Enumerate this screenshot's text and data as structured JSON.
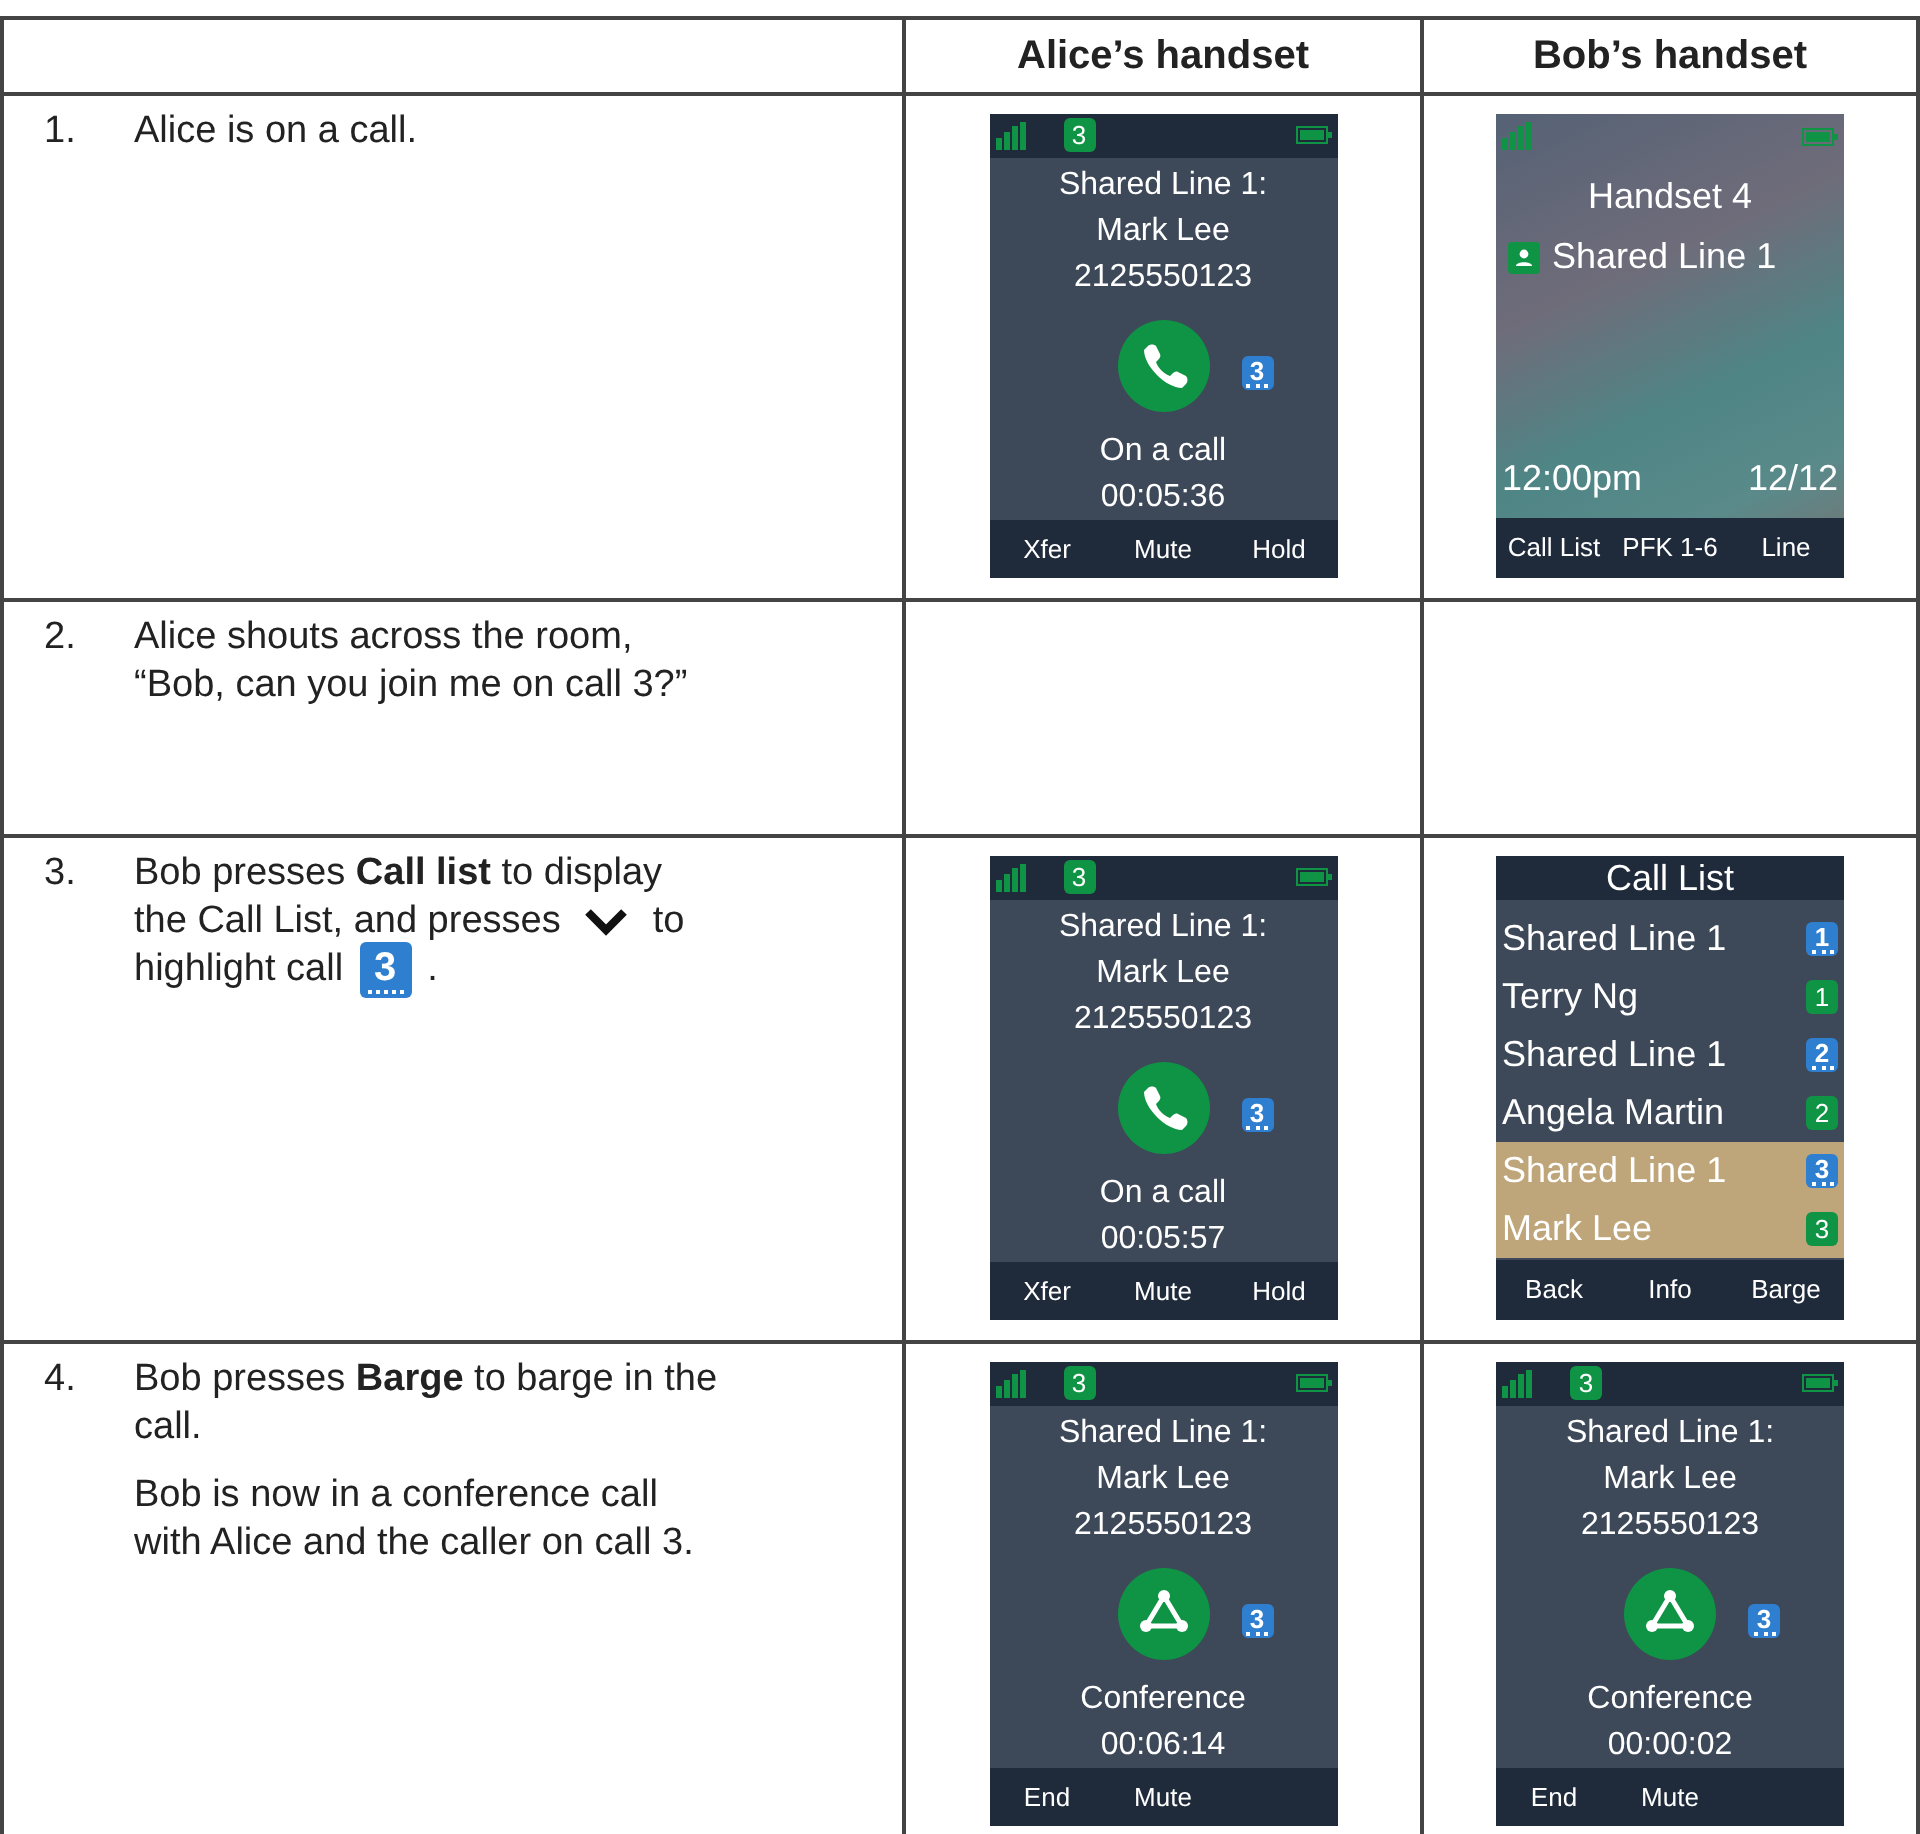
{
  "columns": [
    {
      "label": "Alice’s handset"
    },
    {
      "label": "Bob’s handset"
    }
  ],
  "steps": [
    {
      "number": "1.",
      "paragraphs": [
        [
          [
            {
              "kind": "text",
              "text": "Alice is on a call."
            }
          ]
        ]
      ],
      "alice": {
        "kind": "call",
        "line_badge": "3",
        "lines": [
          "Shared Line 1:",
          "Mark Lee",
          "2125550123"
        ],
        "call_icon": {
          "kind": "phone"
        },
        "call_number": "3",
        "status": "On a call",
        "timer": "00:05:36",
        "softkeys": [
          "Xfer",
          "Mute",
          "Hold"
        ]
      },
      "bob": {
        "kind": "idle",
        "title": "Handset 4",
        "line": "Shared Line 1",
        "time": "12:00pm",
        "date": "12/12",
        "softkeys": [
          "Call List",
          "PFK 1-6",
          "Line"
        ]
      }
    },
    {
      "number": "2.",
      "paragraphs": [
        [
          [
            {
              "kind": "text",
              "text": "Alice shouts across the room,"
            }
          ],
          [
            {
              "kind": "text",
              "text": "“Bob, can you join me on call 3?”"
            }
          ]
        ]
      ]
    },
    {
      "number": "3.",
      "paragraphs": [
        [
          [
            {
              "kind": "text",
              "text": "Bob presses **Call list** to display"
            }
          ],
          [
            {
              "kind": "text",
              "text": "the Call List, and presses"
            },
            {
              "kind": "down_key"
            },
            {
              "kind": "text",
              "text": "to"
            }
          ],
          [
            {
              "kind": "text",
              "text": "highlight call"
            },
            {
              "kind": "call_badge",
              "text": "3"
            },
            {
              "kind": "text",
              "text": "."
            }
          ]
        ]
      ],
      "alice": {
        "kind": "call",
        "line_badge": "3",
        "lines": [
          "Shared Line 1:",
          "Mark Lee",
          "2125550123"
        ],
        "call_icon": {
          "kind": "phone"
        },
        "call_number": "3",
        "status": "On a call",
        "timer": "00:05:57",
        "softkeys": [
          "Xfer",
          "Mute",
          "Hold"
        ]
      },
      "bob": {
        "kind": "call_list",
        "title": "Call List",
        "items": [
          {
            "label": "Shared Line 1",
            "badge": {
              "kind": "shared",
              "text": "1"
            },
            "selected": false
          },
          {
            "label": "Terry Ng",
            "badge": {
              "kind": "call",
              "text": "1"
            },
            "selected": false
          },
          {
            "label": "Shared Line 1",
            "badge": {
              "kind": "shared",
              "text": "2"
            },
            "selected": false
          },
          {
            "label": "Angela Martin",
            "badge": {
              "kind": "call",
              "text": "2"
            },
            "selected": false
          },
          {
            "label": "Shared Line 1",
            "badge": {
              "kind": "shared",
              "text": "3"
            },
            "selected": true
          },
          {
            "label": "Mark Lee",
            "badge": {
              "kind": "call",
              "text": "3"
            },
            "selected": true
          }
        ],
        "softkeys": [
          "Back",
          "Info",
          "Barge"
        ]
      }
    },
    {
      "number": "4.",
      "paragraphs": [
        [
          [
            {
              "kind": "text",
              "text": "Bob presses **Barge** to barge in the"
            }
          ],
          [
            {
              "kind": "text",
              "text": "call."
            }
          ]
        ],
        [
          [
            {
              "kind": "text",
              "text": "Bob is now in a conference call"
            }
          ],
          [
            {
              "kind": "text",
              "text": "with Alice and the caller on call 3."
            }
          ]
        ]
      ],
      "alice": {
        "kind": "call",
        "line_badge": "3",
        "lines": [
          "Shared Line 1:",
          "Mark Lee",
          "2125550123"
        ],
        "call_icon": {
          "kind": "conference"
        },
        "call_number": "3",
        "status": "Conference",
        "timer": "00:06:14",
        "softkeys": [
          "End",
          "Mute"
        ]
      },
      "bob": {
        "kind": "call",
        "line_badge": "3",
        "lines": [
          "Shared Line 1:",
          "Mark Lee",
          "2125550123"
        ],
        "call_icon": {
          "kind": "conference"
        },
        "call_number": "3",
        "status": "Conference",
        "timer": "00:00:02",
        "softkeys": [
          "End",
          "Mute"
        ]
      }
    }
  ]
}
